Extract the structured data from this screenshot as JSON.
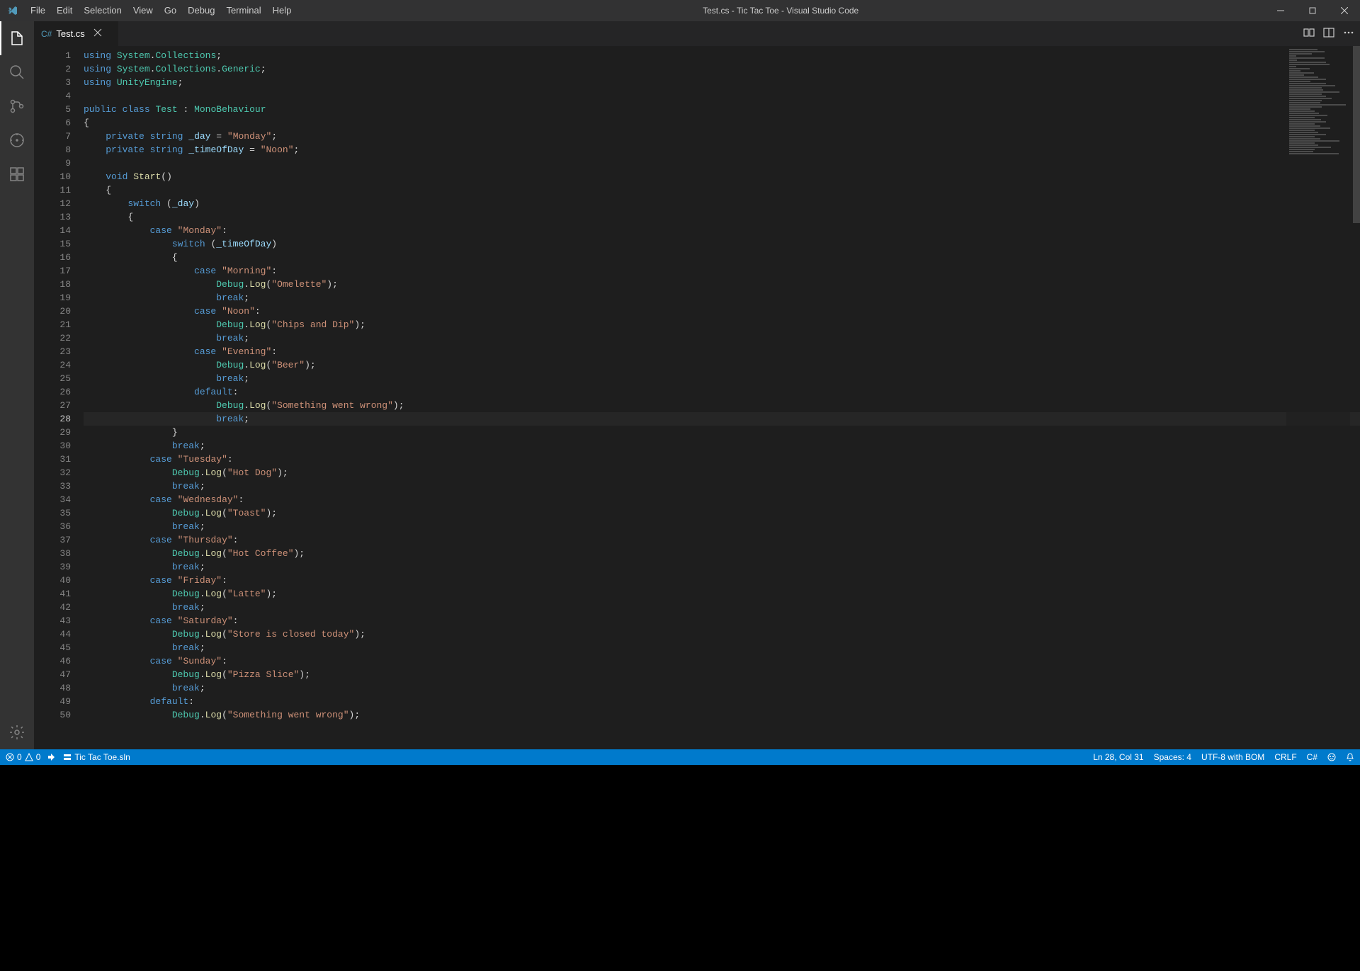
{
  "window": {
    "title": "Test.cs - Tic Tac Toe - Visual Studio Code"
  },
  "menu": {
    "items": [
      "File",
      "Edit",
      "Selection",
      "View",
      "Go",
      "Debug",
      "Terminal",
      "Help"
    ]
  },
  "tab": {
    "file_name": "Test.cs"
  },
  "code_lines": [
    [
      {
        "t": "kw",
        "s": "using"
      },
      {
        "t": "pl",
        "s": " "
      },
      {
        "t": "type",
        "s": "System"
      },
      {
        "t": "pl",
        "s": "."
      },
      {
        "t": "type",
        "s": "Collections"
      },
      {
        "t": "pl",
        "s": ";"
      }
    ],
    [
      {
        "t": "kw",
        "s": "using"
      },
      {
        "t": "pl",
        "s": " "
      },
      {
        "t": "type",
        "s": "System"
      },
      {
        "t": "pl",
        "s": "."
      },
      {
        "t": "type",
        "s": "Collections"
      },
      {
        "t": "pl",
        "s": "."
      },
      {
        "t": "type",
        "s": "Generic"
      },
      {
        "t": "pl",
        "s": ";"
      }
    ],
    [
      {
        "t": "kw",
        "s": "using"
      },
      {
        "t": "pl",
        "s": " "
      },
      {
        "t": "type",
        "s": "UnityEngine"
      },
      {
        "t": "pl",
        "s": ";"
      }
    ],
    [],
    [
      {
        "t": "kw",
        "s": "public"
      },
      {
        "t": "pl",
        "s": " "
      },
      {
        "t": "kw",
        "s": "class"
      },
      {
        "t": "pl",
        "s": " "
      },
      {
        "t": "type",
        "s": "Test"
      },
      {
        "t": "pl",
        "s": " : "
      },
      {
        "t": "type",
        "s": "MonoBehaviour"
      }
    ],
    [
      {
        "t": "pl",
        "s": "{"
      }
    ],
    [
      {
        "t": "pl",
        "s": "    "
      },
      {
        "t": "kw",
        "s": "private"
      },
      {
        "t": "pl",
        "s": " "
      },
      {
        "t": "kw",
        "s": "string"
      },
      {
        "t": "pl",
        "s": " "
      },
      {
        "t": "id",
        "s": "_day"
      },
      {
        "t": "pl",
        "s": " = "
      },
      {
        "t": "str",
        "s": "\"Monday\""
      },
      {
        "t": "pl",
        "s": ";"
      }
    ],
    [
      {
        "t": "pl",
        "s": "    "
      },
      {
        "t": "kw",
        "s": "private"
      },
      {
        "t": "pl",
        "s": " "
      },
      {
        "t": "kw",
        "s": "string"
      },
      {
        "t": "pl",
        "s": " "
      },
      {
        "t": "id",
        "s": "_timeOfDay"
      },
      {
        "t": "pl",
        "s": " = "
      },
      {
        "t": "str",
        "s": "\"Noon\""
      },
      {
        "t": "pl",
        "s": ";"
      }
    ],
    [],
    [
      {
        "t": "pl",
        "s": "    "
      },
      {
        "t": "kw",
        "s": "void"
      },
      {
        "t": "pl",
        "s": " "
      },
      {
        "t": "fn",
        "s": "Start"
      },
      {
        "t": "pl",
        "s": "()"
      }
    ],
    [
      {
        "t": "pl",
        "s": "    {"
      }
    ],
    [
      {
        "t": "pl",
        "s": "        "
      },
      {
        "t": "kw",
        "s": "switch"
      },
      {
        "t": "pl",
        "s": " ("
      },
      {
        "t": "id",
        "s": "_day"
      },
      {
        "t": "pl",
        "s": ")"
      }
    ],
    [
      {
        "t": "pl",
        "s": "        {"
      }
    ],
    [
      {
        "t": "pl",
        "s": "            "
      },
      {
        "t": "kw",
        "s": "case"
      },
      {
        "t": "pl",
        "s": " "
      },
      {
        "t": "str",
        "s": "\"Monday\""
      },
      {
        "t": "pl",
        "s": ":"
      }
    ],
    [
      {
        "t": "pl",
        "s": "                "
      },
      {
        "t": "kw",
        "s": "switch"
      },
      {
        "t": "pl",
        "s": " ("
      },
      {
        "t": "id",
        "s": "_timeOfDay"
      },
      {
        "t": "pl",
        "s": ")"
      }
    ],
    [
      {
        "t": "pl",
        "s": "                {"
      }
    ],
    [
      {
        "t": "pl",
        "s": "                    "
      },
      {
        "t": "kw",
        "s": "case"
      },
      {
        "t": "pl",
        "s": " "
      },
      {
        "t": "str",
        "s": "\"Morning\""
      },
      {
        "t": "pl",
        "s": ":"
      }
    ],
    [
      {
        "t": "pl",
        "s": "                        "
      },
      {
        "t": "type",
        "s": "Debug"
      },
      {
        "t": "pl",
        "s": "."
      },
      {
        "t": "fn",
        "s": "Log"
      },
      {
        "t": "pl",
        "s": "("
      },
      {
        "t": "str",
        "s": "\"Omelette\""
      },
      {
        "t": "pl",
        "s": ");"
      }
    ],
    [
      {
        "t": "pl",
        "s": "                        "
      },
      {
        "t": "kw",
        "s": "break"
      },
      {
        "t": "pl",
        "s": ";"
      }
    ],
    [
      {
        "t": "pl",
        "s": "                    "
      },
      {
        "t": "kw",
        "s": "case"
      },
      {
        "t": "pl",
        "s": " "
      },
      {
        "t": "str",
        "s": "\"Noon\""
      },
      {
        "t": "pl",
        "s": ":"
      }
    ],
    [
      {
        "t": "pl",
        "s": "                        "
      },
      {
        "t": "type",
        "s": "Debug"
      },
      {
        "t": "pl",
        "s": "."
      },
      {
        "t": "fn",
        "s": "Log"
      },
      {
        "t": "pl",
        "s": "("
      },
      {
        "t": "str",
        "s": "\"Chips and Dip\""
      },
      {
        "t": "pl",
        "s": ");"
      }
    ],
    [
      {
        "t": "pl",
        "s": "                        "
      },
      {
        "t": "kw",
        "s": "break"
      },
      {
        "t": "pl",
        "s": ";"
      }
    ],
    [
      {
        "t": "pl",
        "s": "                    "
      },
      {
        "t": "kw",
        "s": "case"
      },
      {
        "t": "pl",
        "s": " "
      },
      {
        "t": "str",
        "s": "\"Evening\""
      },
      {
        "t": "pl",
        "s": ":"
      }
    ],
    [
      {
        "t": "pl",
        "s": "                        "
      },
      {
        "t": "type",
        "s": "Debug"
      },
      {
        "t": "pl",
        "s": "."
      },
      {
        "t": "fn",
        "s": "Log"
      },
      {
        "t": "pl",
        "s": "("
      },
      {
        "t": "str",
        "s": "\"Beer\""
      },
      {
        "t": "pl",
        "s": ");"
      }
    ],
    [
      {
        "t": "pl",
        "s": "                        "
      },
      {
        "t": "kw",
        "s": "break"
      },
      {
        "t": "pl",
        "s": ";"
      }
    ],
    [
      {
        "t": "pl",
        "s": "                    "
      },
      {
        "t": "kw",
        "s": "default"
      },
      {
        "t": "pl",
        "s": ":"
      }
    ],
    [
      {
        "t": "pl",
        "s": "                        "
      },
      {
        "t": "type",
        "s": "Debug"
      },
      {
        "t": "pl",
        "s": "."
      },
      {
        "t": "fn",
        "s": "Log"
      },
      {
        "t": "pl",
        "s": "("
      },
      {
        "t": "str",
        "s": "\"Something went wrong\""
      },
      {
        "t": "pl",
        "s": ");"
      }
    ],
    [
      {
        "t": "pl",
        "s": "                        "
      },
      {
        "t": "kw",
        "s": "break"
      },
      {
        "t": "pl",
        "s": ";"
      }
    ],
    [
      {
        "t": "pl",
        "s": "                }"
      }
    ],
    [
      {
        "t": "pl",
        "s": "                "
      },
      {
        "t": "kw",
        "s": "break"
      },
      {
        "t": "pl",
        "s": ";"
      }
    ],
    [
      {
        "t": "pl",
        "s": "            "
      },
      {
        "t": "kw",
        "s": "case"
      },
      {
        "t": "pl",
        "s": " "
      },
      {
        "t": "str",
        "s": "\"Tuesday\""
      },
      {
        "t": "pl",
        "s": ":"
      }
    ],
    [
      {
        "t": "pl",
        "s": "                "
      },
      {
        "t": "type",
        "s": "Debug"
      },
      {
        "t": "pl",
        "s": "."
      },
      {
        "t": "fn",
        "s": "Log"
      },
      {
        "t": "pl",
        "s": "("
      },
      {
        "t": "str",
        "s": "\"Hot Dog\""
      },
      {
        "t": "pl",
        "s": ");"
      }
    ],
    [
      {
        "t": "pl",
        "s": "                "
      },
      {
        "t": "kw",
        "s": "break"
      },
      {
        "t": "pl",
        "s": ";"
      }
    ],
    [
      {
        "t": "pl",
        "s": "            "
      },
      {
        "t": "kw",
        "s": "case"
      },
      {
        "t": "pl",
        "s": " "
      },
      {
        "t": "str",
        "s": "\"Wednesday\""
      },
      {
        "t": "pl",
        "s": ":"
      }
    ],
    [
      {
        "t": "pl",
        "s": "                "
      },
      {
        "t": "type",
        "s": "Debug"
      },
      {
        "t": "pl",
        "s": "."
      },
      {
        "t": "fn",
        "s": "Log"
      },
      {
        "t": "pl",
        "s": "("
      },
      {
        "t": "str",
        "s": "\"Toast\""
      },
      {
        "t": "pl",
        "s": ");"
      }
    ],
    [
      {
        "t": "pl",
        "s": "                "
      },
      {
        "t": "kw",
        "s": "break"
      },
      {
        "t": "pl",
        "s": ";"
      }
    ],
    [
      {
        "t": "pl",
        "s": "            "
      },
      {
        "t": "kw",
        "s": "case"
      },
      {
        "t": "pl",
        "s": " "
      },
      {
        "t": "str",
        "s": "\"Thursday\""
      },
      {
        "t": "pl",
        "s": ":"
      }
    ],
    [
      {
        "t": "pl",
        "s": "                "
      },
      {
        "t": "type",
        "s": "Debug"
      },
      {
        "t": "pl",
        "s": "."
      },
      {
        "t": "fn",
        "s": "Log"
      },
      {
        "t": "pl",
        "s": "("
      },
      {
        "t": "str",
        "s": "\"Hot Coffee\""
      },
      {
        "t": "pl",
        "s": ");"
      }
    ],
    [
      {
        "t": "pl",
        "s": "                "
      },
      {
        "t": "kw",
        "s": "break"
      },
      {
        "t": "pl",
        "s": ";"
      }
    ],
    [
      {
        "t": "pl",
        "s": "            "
      },
      {
        "t": "kw",
        "s": "case"
      },
      {
        "t": "pl",
        "s": " "
      },
      {
        "t": "str",
        "s": "\"Friday\""
      },
      {
        "t": "pl",
        "s": ":"
      }
    ],
    [
      {
        "t": "pl",
        "s": "                "
      },
      {
        "t": "type",
        "s": "Debug"
      },
      {
        "t": "pl",
        "s": "."
      },
      {
        "t": "fn",
        "s": "Log"
      },
      {
        "t": "pl",
        "s": "("
      },
      {
        "t": "str",
        "s": "\"Latte\""
      },
      {
        "t": "pl",
        "s": ");"
      }
    ],
    [
      {
        "t": "pl",
        "s": "                "
      },
      {
        "t": "kw",
        "s": "break"
      },
      {
        "t": "pl",
        "s": ";"
      }
    ],
    [
      {
        "t": "pl",
        "s": "            "
      },
      {
        "t": "kw",
        "s": "case"
      },
      {
        "t": "pl",
        "s": " "
      },
      {
        "t": "str",
        "s": "\"Saturday\""
      },
      {
        "t": "pl",
        "s": ":"
      }
    ],
    [
      {
        "t": "pl",
        "s": "                "
      },
      {
        "t": "type",
        "s": "Debug"
      },
      {
        "t": "pl",
        "s": "."
      },
      {
        "t": "fn",
        "s": "Log"
      },
      {
        "t": "pl",
        "s": "("
      },
      {
        "t": "str",
        "s": "\"Store is closed today\""
      },
      {
        "t": "pl",
        "s": ");"
      }
    ],
    [
      {
        "t": "pl",
        "s": "                "
      },
      {
        "t": "kw",
        "s": "break"
      },
      {
        "t": "pl",
        "s": ";"
      }
    ],
    [
      {
        "t": "pl",
        "s": "            "
      },
      {
        "t": "kw",
        "s": "case"
      },
      {
        "t": "pl",
        "s": " "
      },
      {
        "t": "str",
        "s": "\"Sunday\""
      },
      {
        "t": "pl",
        "s": ":"
      }
    ],
    [
      {
        "t": "pl",
        "s": "                "
      },
      {
        "t": "type",
        "s": "Debug"
      },
      {
        "t": "pl",
        "s": "."
      },
      {
        "t": "fn",
        "s": "Log"
      },
      {
        "t": "pl",
        "s": "("
      },
      {
        "t": "str",
        "s": "\"Pizza Slice\""
      },
      {
        "t": "pl",
        "s": ");"
      }
    ],
    [
      {
        "t": "pl",
        "s": "                "
      },
      {
        "t": "kw",
        "s": "break"
      },
      {
        "t": "pl",
        "s": ";"
      }
    ],
    [
      {
        "t": "pl",
        "s": "            "
      },
      {
        "t": "kw",
        "s": "default"
      },
      {
        "t": "pl",
        "s": ":"
      }
    ],
    [
      {
        "t": "pl",
        "s": "                "
      },
      {
        "t": "type",
        "s": "Debug"
      },
      {
        "t": "pl",
        "s": "."
      },
      {
        "t": "fn",
        "s": "Log"
      },
      {
        "t": "pl",
        "s": "("
      },
      {
        "t": "str",
        "s": "\"Something went wrong\""
      },
      {
        "t": "pl",
        "s": ");"
      }
    ]
  ],
  "current_line": 28,
  "status": {
    "errors": "0",
    "warnings": "0",
    "solution": "Tic Tac Toe.sln",
    "cursor": "Ln 28, Col 31",
    "spaces": "Spaces: 4",
    "encoding": "UTF-8 with BOM",
    "eol": "CRLF",
    "language": "C#"
  }
}
